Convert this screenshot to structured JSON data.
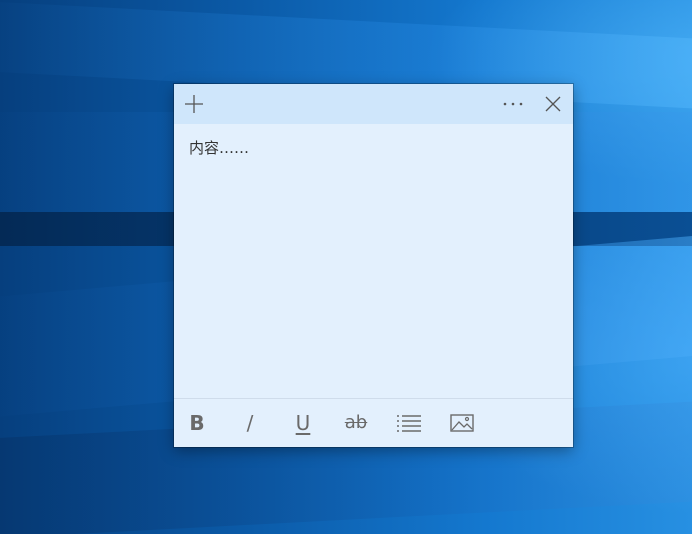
{
  "note": {
    "content": "内容……",
    "colors": {
      "background": "#e3f0fd",
      "titlebar": "#cfe6fb",
      "icon": "#6a6a6a"
    }
  },
  "titlebar": {
    "add_icon": "plus-icon",
    "menu_icon": "more-icon",
    "close_icon": "close-icon"
  },
  "toolbar": {
    "bold_label": "B",
    "italic_label": "/",
    "underline_label": "U",
    "strikethrough_label": "ab",
    "list_icon": "bullet-list-icon",
    "image_icon": "image-icon"
  }
}
